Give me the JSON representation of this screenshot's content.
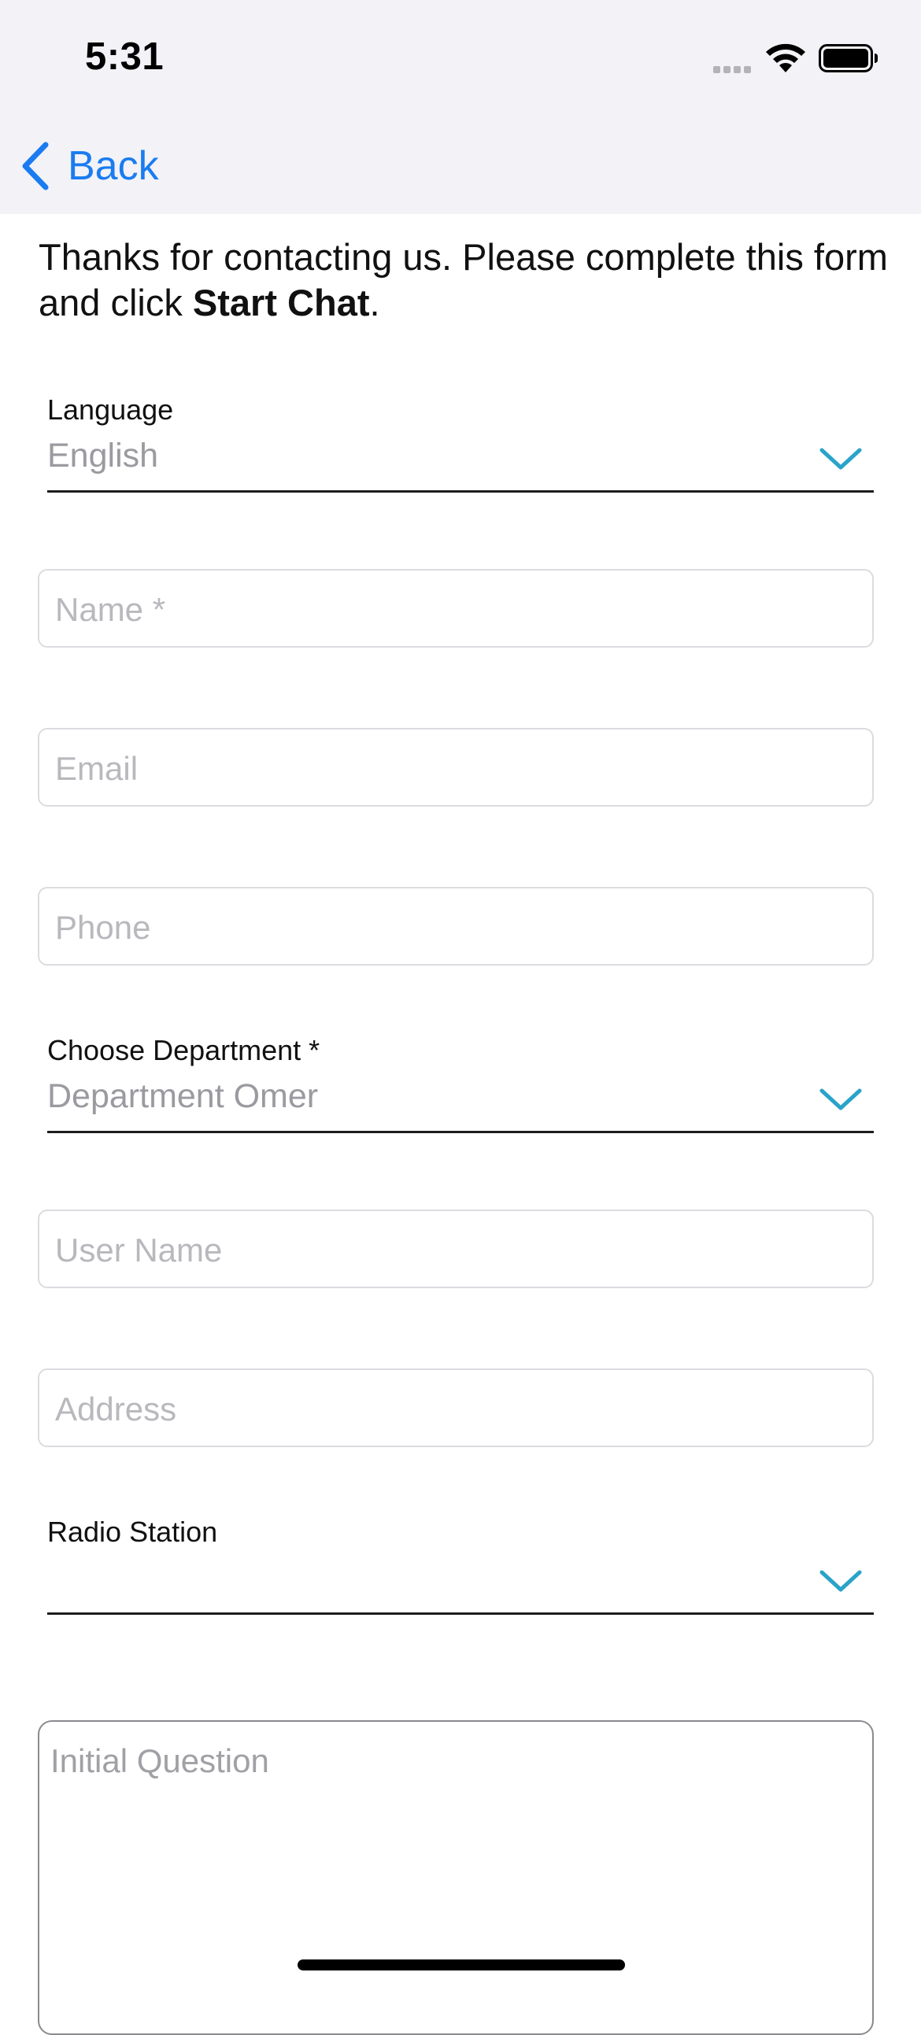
{
  "status_bar": {
    "time": "5:31",
    "icons": [
      "cellular-signal-icon",
      "wifi-icon",
      "battery-icon"
    ]
  },
  "nav": {
    "back_label": "Back",
    "back_icon": "chevron-left-icon"
  },
  "intro": {
    "text_before": "Thanks for contacting us. Please complete this form and click ",
    "bold": "Start Chat",
    "text_after": "."
  },
  "form": {
    "language": {
      "label": "Language",
      "value": "English"
    },
    "name": {
      "placeholder": "Name *"
    },
    "email": {
      "placeholder": "Email"
    },
    "phone": {
      "placeholder": "Phone"
    },
    "department": {
      "label": "Choose Department *",
      "value": "Department Omer"
    },
    "user_name": {
      "placeholder": "User Name"
    },
    "address": {
      "placeholder": "Address"
    },
    "radio_station": {
      "label": "Radio Station",
      "value": ""
    },
    "initial_question": {
      "placeholder": "Initial Question"
    }
  },
  "colors": {
    "accent_blue": "#1a7cf0",
    "chevron_teal": "#2aa3c9",
    "bar_background": "#f2f2f7"
  }
}
